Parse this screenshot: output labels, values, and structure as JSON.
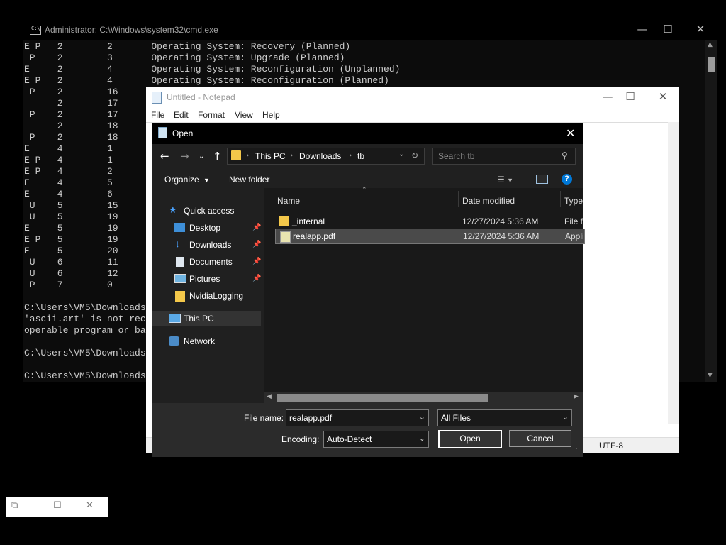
{
  "cmd": {
    "title": "Administrator: C:\\Windows\\system32\\cmd.exe",
    "rows": [
      {
        "flags": "E P",
        "a": "2",
        "b": "2",
        "desc": "Operating System: Recovery (Planned)"
      },
      {
        "flags": " P",
        "a": "2",
        "b": "3",
        "desc": "Operating System: Upgrade (Planned)"
      },
      {
        "flags": "E",
        "a": "2",
        "b": "4",
        "desc": "Operating System: Reconfiguration (Unplanned)"
      },
      {
        "flags": "E P",
        "a": "2",
        "b": "4",
        "desc": "Operating System: Reconfiguration (Planned)"
      },
      {
        "flags": " P",
        "a": "2",
        "b": "16",
        "desc": ""
      },
      {
        "flags": "",
        "a": "2",
        "b": "17",
        "desc": ""
      },
      {
        "flags": " P",
        "a": "2",
        "b": "17",
        "desc": ""
      },
      {
        "flags": "",
        "a": "2",
        "b": "18",
        "desc": ""
      },
      {
        "flags": " P",
        "a": "2",
        "b": "18",
        "desc": ""
      },
      {
        "flags": "E",
        "a": "4",
        "b": "1",
        "desc": ""
      },
      {
        "flags": "E P",
        "a": "4",
        "b": "1",
        "desc": ""
      },
      {
        "flags": "E P",
        "a": "4",
        "b": "2",
        "desc": ""
      },
      {
        "flags": "E",
        "a": "4",
        "b": "5",
        "desc": ""
      },
      {
        "flags": "E",
        "a": "4",
        "b": "6",
        "desc": ""
      },
      {
        "flags": " U",
        "a": "5",
        "b": "15",
        "desc": ""
      },
      {
        "flags": " U",
        "a": "5",
        "b": "19",
        "desc": ""
      },
      {
        "flags": "E",
        "a": "5",
        "b": "19",
        "desc": ""
      },
      {
        "flags": "E P",
        "a": "5",
        "b": "19",
        "desc": ""
      },
      {
        "flags": "E",
        "a": "5",
        "b": "20",
        "desc": ""
      },
      {
        "flags": " U",
        "a": "6",
        "b": "11",
        "desc": ""
      },
      {
        "flags": " U",
        "a": "6",
        "b": "12",
        "desc": ""
      },
      {
        "flags": " P",
        "a": "7",
        "b": "0",
        "desc": ""
      }
    ],
    "tail_lines": [
      "",
      "C:\\Users\\VM5\\Downloads",
      "'ascii.art' is not rec",
      "operable program or ba",
      "",
      "C:\\Users\\VM5\\Downloads",
      "",
      "C:\\Users\\VM5\\Downloads"
    ]
  },
  "notepad": {
    "title": "Untitled - Notepad",
    "menu": [
      "File",
      "Edit",
      "Format",
      "View",
      "Help"
    ],
    "encoding": "UTF-8"
  },
  "dialog": {
    "title": "Open",
    "path": [
      "This PC",
      "Downloads",
      "tb"
    ],
    "search_placeholder": "Search tb",
    "organize": "Organize",
    "new_folder": "New folder",
    "nav": [
      {
        "label": "Quick access",
        "pinned": false,
        "icon": "star-icon"
      },
      {
        "label": "Desktop",
        "pinned": true,
        "icon": "desktop-icon"
      },
      {
        "label": "Downloads",
        "pinned": true,
        "icon": "download-icon"
      },
      {
        "label": "Documents",
        "pinned": true,
        "icon": "documents-icon"
      },
      {
        "label": "Pictures",
        "pinned": true,
        "icon": "pictures-icon"
      },
      {
        "label": "NvidiaLogging",
        "pinned": false,
        "icon": "folder-icon"
      },
      {
        "label": "This PC",
        "pinned": false,
        "icon": "computer-icon",
        "selected": true
      },
      {
        "label": "Network",
        "pinned": false,
        "icon": "network-icon"
      }
    ],
    "columns": [
      "Name",
      "Date modified",
      "Type"
    ],
    "files": [
      {
        "name": "_internal",
        "date": "12/27/2024 5:36 AM",
        "type": "File fo",
        "icon": "folder-icon",
        "selected": false
      },
      {
        "name": "realapp.pdf",
        "date": "12/27/2024 5:36 AM",
        "type": "Appli",
        "icon": "pdf-app-icon",
        "selected": true
      }
    ],
    "file_name_label": "File name:",
    "file_name_value": "realapp.pdf",
    "file_type_value": "All Files",
    "encoding_label": "Encoding:",
    "encoding_value": "Auto-Detect",
    "open_label": "Open",
    "cancel_label": "Cancel"
  },
  "colors": {
    "accent": "#0078d7",
    "folder": "#f4c84a",
    "dialog_bg": "#202020"
  }
}
